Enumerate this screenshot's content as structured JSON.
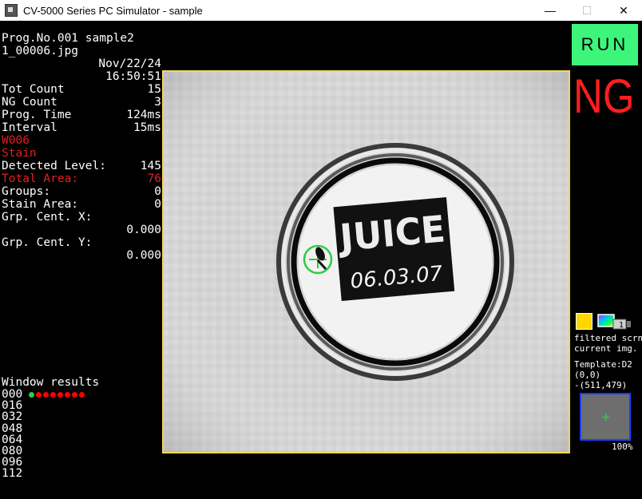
{
  "window": {
    "title": "CV-5000 Series PC Simulator - sample",
    "minimize": "—",
    "maximize": "☐",
    "close": "✕"
  },
  "info": {
    "program": "Prog.No.001 sample2",
    "file": "1_00006.jpg",
    "date": "Nov/22/24",
    "time": "16:50:51",
    "tot_count_label": "Tot Count",
    "tot_count": "15",
    "ng_count_label": "NG Count",
    "ng_count": "3",
    "prog_time_label": "Prog. Time",
    "prog_time": "124ms",
    "interval_label": "Interval",
    "interval": "15ms",
    "window_id": "W006",
    "tool_name": "Stain",
    "detected_level_label": "Detected Level:",
    "detected_level": "145",
    "total_area_label": "Total Area:",
    "total_area": "76",
    "groups_label": "Groups:",
    "groups": "0",
    "stain_area_label": "Stain Area:",
    "stain_area": "0",
    "grp_cent_x_label": "Grp. Cent. X:",
    "grp_cent_x": "0.000",
    "grp_cent_y_label": "Grp. Cent. Y:",
    "grp_cent_y": "0.000"
  },
  "window_results": {
    "title": "Window results",
    "rows": [
      "000",
      "016",
      "032",
      "048",
      "064",
      "080",
      "096",
      "112"
    ],
    "dot_colors": [
      "#2ecc40",
      "#ff0000",
      "#ff0000",
      "#ff0000",
      "#ff0000",
      "#ff0000",
      "#ff0000",
      "#ff0000"
    ]
  },
  "image": {
    "label_brand": "JUICE",
    "label_date": "06.03.07",
    "frame_color": "#f4d35e",
    "marker_color": "#2ecc40"
  },
  "status": {
    "run_label": "RUN",
    "result": "NG",
    "run_color": "#3cf57a",
    "ng_color": "#ff1d1d"
  },
  "side": {
    "filtered_label": "filtered scrn",
    "current_label": "current img.",
    "template_label": "Template:D2",
    "origin": "(0,0)",
    "extent": "-(511,479)",
    "zoom": "100%",
    "camera_number": "1"
  }
}
